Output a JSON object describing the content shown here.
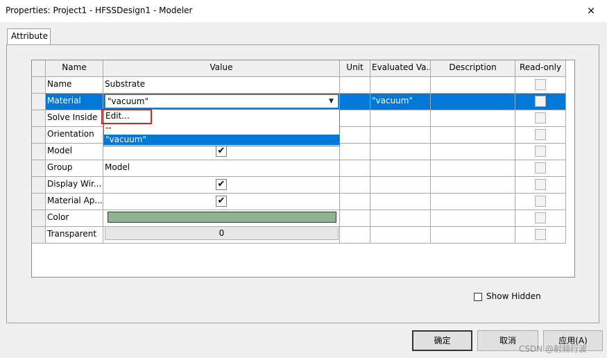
{
  "window": {
    "title": "Properties: Project1 - HFSSDesign1 - Modeler",
    "close_icon": "×"
  },
  "tabs": [
    {
      "label": "Attribute",
      "selected": true
    }
  ],
  "grid": {
    "columns": [
      "Name",
      "Value",
      "Unit",
      "Evaluated Va...",
      "Description",
      "Read-only"
    ],
    "rows": [
      {
        "name": "Name",
        "value": "Substrate"
      },
      {
        "name": "Material",
        "value": "\"vacuum\"",
        "evaluated": "\"vacuum\"",
        "selected": true
      },
      {
        "name": "Solve Inside"
      },
      {
        "name": "Orientation"
      },
      {
        "name": "Model",
        "checked": true
      },
      {
        "name": "Group",
        "value": "Model"
      },
      {
        "name": "Display Wir...",
        "checked": true
      },
      {
        "name": "Material Ap...",
        "checked": true
      },
      {
        "name": "Color",
        "swatch": "#8fb28f"
      },
      {
        "name": "Transparent",
        "value": "0"
      }
    ]
  },
  "material_dropdown": {
    "selected": "\"vacuum\"",
    "options": [
      "Edit...",
      "--",
      "\"vacuum\""
    ],
    "highlighted": "\"vacuum\""
  },
  "show_hidden": {
    "label": "Show Hidden",
    "checked": false
  },
  "buttons": {
    "ok": "确定",
    "cancel": "取消",
    "apply": "应用(A)"
  },
  "watermark": "CSDN @射频行波",
  "colors": {
    "selection": "#0078d7",
    "highlight_box": "#e02020"
  }
}
